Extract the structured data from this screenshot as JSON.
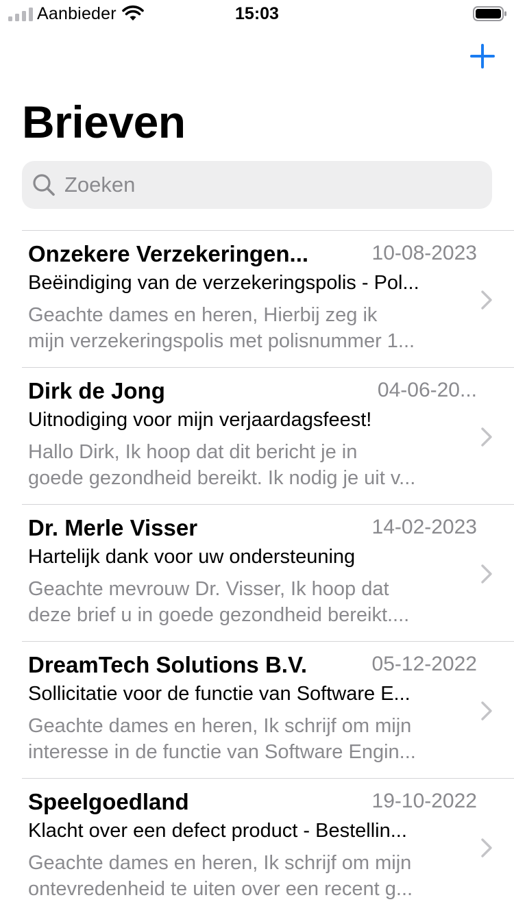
{
  "status_bar": {
    "carrier": "Aanbieder",
    "time": "15:03"
  },
  "nav": {
    "add_icon": "plus-icon",
    "title": "Brieven"
  },
  "search": {
    "placeholder": "Zoeken",
    "value": ""
  },
  "colors": {
    "accent": "#1a7cf1",
    "secondary_text": "#8a8a8e",
    "search_bg": "#eeeeef",
    "separator": "#d4d4d7"
  },
  "letters": [
    {
      "sender": "Onzekere Verzekeringen...",
      "date": "10-08-2023",
      "subject": "Beëindiging van de verzekeringspolis - Pol...",
      "preview_line1": "Geachte dames en heren,  Hierbij zeg ik",
      "preview_line2": "mijn verzekeringspolis met polisnummer 1..."
    },
    {
      "sender": "Dirk de Jong",
      "date": "04-06-20...",
      "subject": "Uitnodiging voor mijn verjaardagsfeest!",
      "preview_line1": "Hallo Dirk,  Ik hoop dat dit bericht je in",
      "preview_line2": "goede gezondheid bereikt. Ik nodig je uit v..."
    },
    {
      "sender": "Dr. Merle Visser",
      "date": "14-02-2023",
      "subject": "Hartelijk dank voor uw ondersteuning",
      "preview_line1": "Geachte mevrouw Dr. Visser,  Ik hoop dat",
      "preview_line2": "deze brief u in goede gezondheid bereikt...."
    },
    {
      "sender": "DreamTech Solutions B.V.",
      "date": "05-12-2022",
      "subject": "Sollicitatie voor de functie van Software E...",
      "preview_line1": "Geachte dames en heren,  Ik schrijf om mijn",
      "preview_line2": "interesse in de functie van Software Engin..."
    },
    {
      "sender": "Speelgoedland",
      "date": "19-10-2022",
      "subject": "Klacht over een defect product - Bestellin...",
      "preview_line1": "Geachte dames en heren,  Ik schrijf om mijn",
      "preview_line2": "ontevredenheid te uiten over een recent g..."
    }
  ]
}
